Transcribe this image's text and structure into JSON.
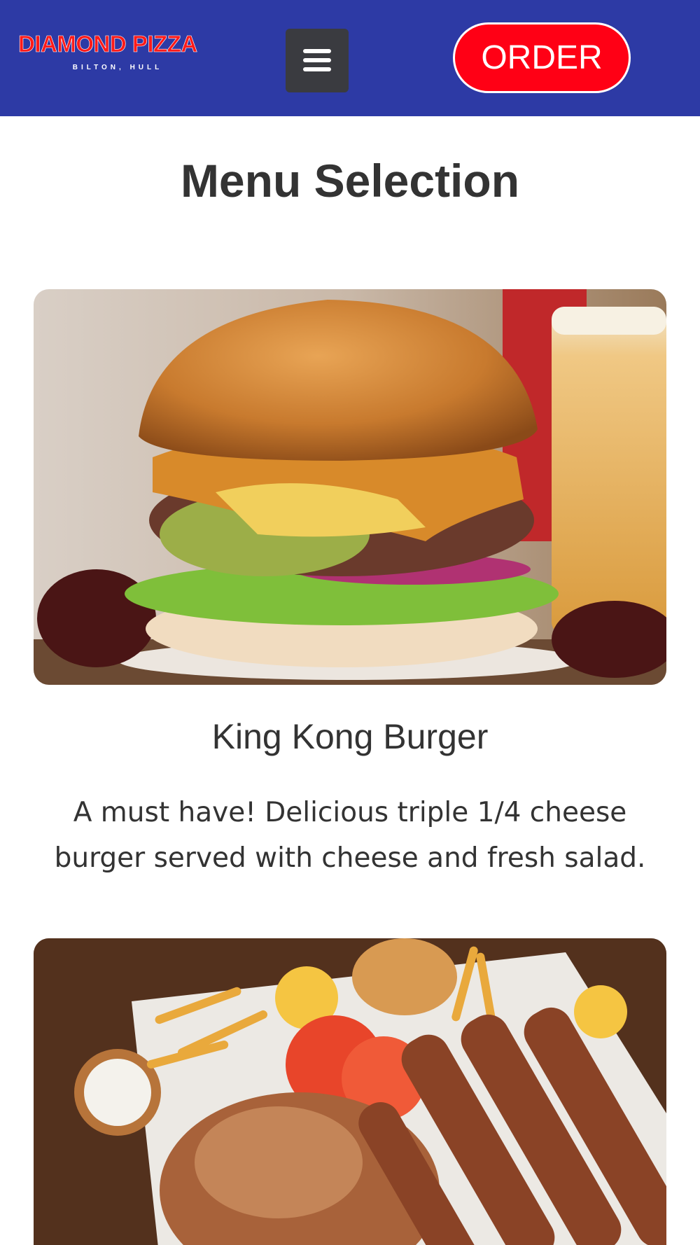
{
  "header": {
    "logo_title": "DIAMOND PIZZA",
    "logo_subtitle": "BILTON, HULL",
    "menu_icon": "hamburger-menu-icon",
    "order_label": "ORDER",
    "colors": {
      "header_bg": "#2d3aa5",
      "order_bg": "#ff0015",
      "logo_red": "#ff1a1a",
      "menu_bg": "#3a3b40"
    }
  },
  "main": {
    "title": "Menu Selection",
    "items": [
      {
        "name": "King Kong Burger",
        "description": "A must have! Delicious triple 1/4 cheese burger served with cheese and fresh salad.",
        "image": "burger-photo"
      },
      {
        "image": "kebab-platter-photo"
      }
    ]
  }
}
